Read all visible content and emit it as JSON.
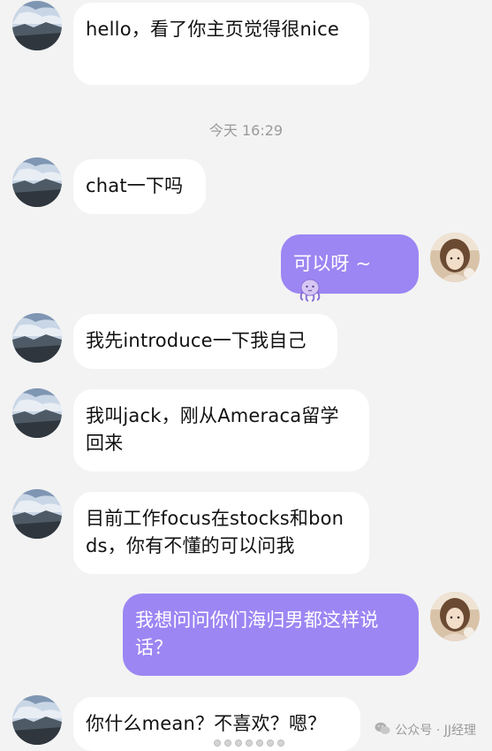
{
  "timestamp": "今天 16:29",
  "messages": [
    {
      "side": "in",
      "text": "hello，看了你主页觉得很nice"
    },
    {
      "side": "in",
      "text": "chat一下吗"
    },
    {
      "side": "out",
      "text": "可以呀 ~"
    },
    {
      "side": "in",
      "text": "我先introduce一下我自己"
    },
    {
      "side": "in",
      "text": "我叫jack，刚从Ameraca留学回来"
    },
    {
      "side": "in",
      "text": "目前工作focus在stocks和bonds，你有不懂的可以问我"
    },
    {
      "side": "out",
      "text": "我想问问你们海归男都这样说话？"
    },
    {
      "side": "in",
      "text": "你什么mean？不喜欢？嗯？"
    }
  ],
  "emoji": "octopus-emoji",
  "watermark": "公众号 · JJ经理",
  "colors": {
    "background": "#f3f3f3",
    "incoming_bubble": "#ffffff",
    "outgoing_bubble": "#9c86f3"
  }
}
